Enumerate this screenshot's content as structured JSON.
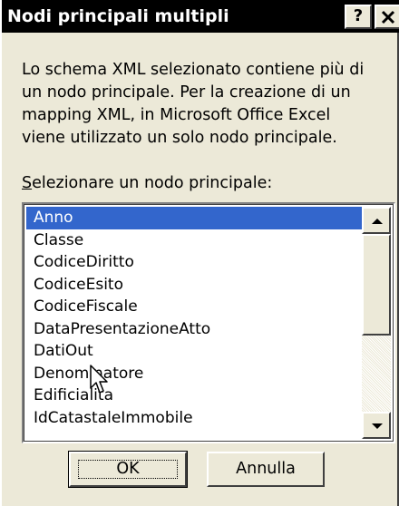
{
  "dialog": {
    "title": "Nodi principali multipli",
    "help_label": "?",
    "description_lines": [
      "Lo schema XML selezionato contiene più di",
      "un nodo principale. Per la creazione di un",
      "mapping XML, in Microsoft Office Excel",
      "viene utilizzato un solo nodo principale."
    ],
    "select_label_accel": "S",
    "select_label_rest": "elezionare un nodo principale:",
    "list": {
      "items": [
        "Anno",
        "Classe",
        "CodiceDiritto",
        "CodiceEsito",
        "CodiceFiscale",
        "DataPresentazioneAtto",
        "DatiOut",
        "Denominatore",
        "Edificialita",
        "IdCatastaleImmobile"
      ],
      "selected_index": 0
    },
    "buttons": {
      "ok_label": "OK",
      "cancel_label": "Annulla"
    }
  },
  "colors": {
    "titlebar": "#000000",
    "dialog_bg": "#ece9d8",
    "selection": "#3366cc"
  },
  "icons": {
    "close": "close-icon",
    "scroll_up": "arrow-up-icon",
    "scroll_down": "arrow-down-icon",
    "cursor": "mouse-pointer-icon"
  }
}
